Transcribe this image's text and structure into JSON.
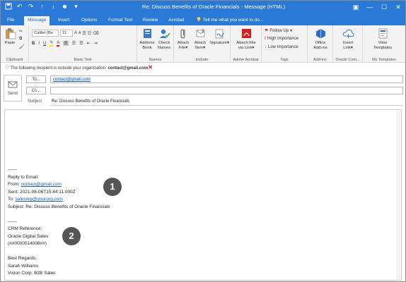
{
  "window": {
    "title": "Re: Discuss Benefits of Oracle Financials - Message (HTML)",
    "controls": [
      "▣",
      "—",
      "☐",
      "✕"
    ]
  },
  "qat_icons": [
    "save-icon",
    "undo-icon",
    "redo-icon",
    "up-arrow-icon",
    "down-arrow-icon",
    "person-icon",
    "customize-icon"
  ],
  "tabs": [
    {
      "label": "File"
    },
    {
      "label": "Message"
    },
    {
      "label": "Insert"
    },
    {
      "label": "Options"
    },
    {
      "label": "Format Text"
    },
    {
      "label": "Review"
    },
    {
      "label": "Acrobat"
    }
  ],
  "tellme": "Tell me what you want to do...",
  "ribbon": {
    "clipboard": {
      "label": "Clipboard",
      "paste": "Paste"
    },
    "basic_text": {
      "label": "Basic Text",
      "font": "Calibri (Bo",
      "size": "11",
      "bold": "B",
      "italic": "I",
      "underline": "U",
      "font_color": "A"
    },
    "names": {
      "label": "Names",
      "address_book_1": "Address",
      "address_book_2": "Book",
      "check_names_1": "Check",
      "check_names_2": "Names"
    },
    "include": {
      "label": "Include",
      "attach_file_1": "Attach",
      "attach_file_2": "File",
      "attach_item_1": "Attach",
      "attach_item_2": "Item",
      "signature_1": "Signature",
      "signature_2": ""
    },
    "acrobat": {
      "label": "Adobe Acrobat",
      "attach_via_link_1": "Attach File",
      "attach_via_link_2": "via Link"
    },
    "tags": {
      "label": "Tags",
      "follow_up": "Follow Up",
      "high_importance": "High Importance",
      "low_importance": "Low Importance"
    },
    "addins": {
      "label": "Add-ins",
      "office_addins_1": "Office",
      "office_addins_2": "Add-ins"
    },
    "oracle": {
      "label": "Oracle Cont...",
      "insert_link_1": "Insert",
      "insert_link_2": "Link"
    },
    "templates": {
      "label": "My Templates",
      "view_templates_1": "View",
      "view_templates_2": "Templates"
    }
  },
  "infobar": {
    "text": "The following recipient is outside your organization: ",
    "email": "contact@gmail.com"
  },
  "header": {
    "send": "Send",
    "to_label": "To...",
    "to_value": "contact@gmail.com",
    "cc_label": "Cc...",
    "cc_value": "",
    "subject_label": "Subject",
    "subject_value": "Re: Discuss Benefits of Oracle Financials"
  },
  "body": {
    "sep1": "------",
    "reply_to": "Reply to Email:",
    "from_label": "From: ",
    "from_value": "contact@gmail.com",
    "sent": "Sent: 2021-08-06T15:44:11.000Z",
    "to_label": "To: ",
    "to_value": "salesrep@yourorg.com",
    "subject": "Subject: Re: Discuss Benefits of Oracle Financials",
    "sep2": "------",
    "crm_ref": "CRM Reference:",
    "org": "Oracle Digital Sales",
    "ref_id": "(##0000014008##)",
    "regards": "Best Regards,",
    "name": "Sarah Williams",
    "company": "Vision Corp. B2B Sales"
  },
  "callouts": [
    "1",
    "2"
  ],
  "colors": {
    "accent": "#2b79d6",
    "link": "#1a5fb4",
    "callout": "#555555"
  }
}
